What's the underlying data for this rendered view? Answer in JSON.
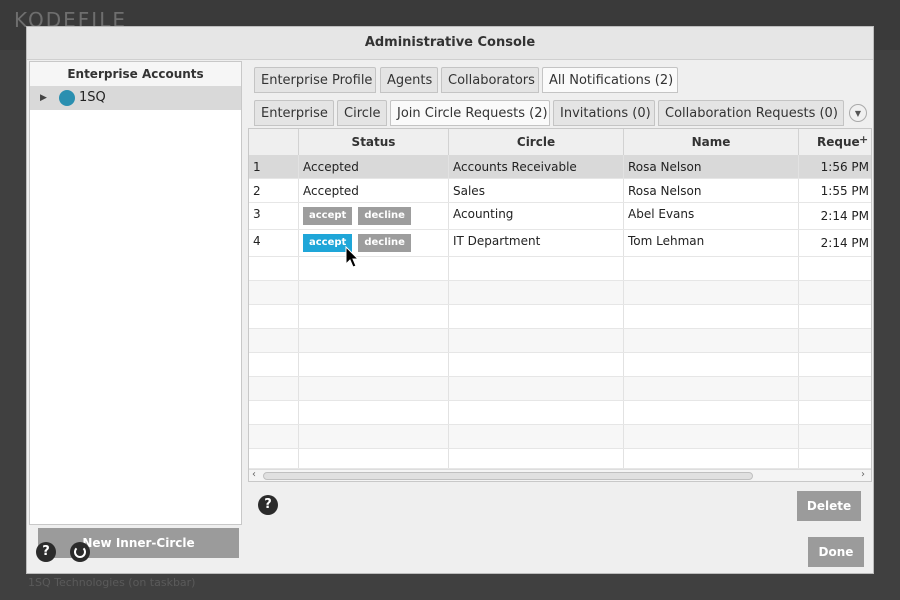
{
  "dialog": {
    "title": "Administrative Console"
  },
  "left_panel": {
    "header": "Enterprise Accounts",
    "tree": [
      {
        "label": "1SQ",
        "icon": "enterprise-icon",
        "expanded": false,
        "selected": true
      }
    ],
    "new_button": "New Inner-Circle"
  },
  "tabs_primary": [
    {
      "label": "Enterprise Profile",
      "active": false
    },
    {
      "label": "Agents",
      "active": false
    },
    {
      "label": "Collaborators",
      "active": false
    },
    {
      "label": "All Notifications (2)",
      "active": true
    }
  ],
  "tabs_secondary": [
    {
      "label": "Enterprise",
      "active": false
    },
    {
      "label": "Circle",
      "active": false
    },
    {
      "label": "Join Circle Requests (2)",
      "active": true
    },
    {
      "label": "Invitations (0)",
      "active": false
    },
    {
      "label": "Collaboration Requests (0)",
      "active": false
    }
  ],
  "table": {
    "columns": [
      "",
      "Status",
      "Circle",
      "Name",
      "Reque"
    ],
    "rows": [
      {
        "num": "1",
        "status": "Accepted",
        "circle": "Accounts Receivable",
        "name": "Rosa Nelson",
        "time": "1:56 PM"
      },
      {
        "num": "2",
        "status": "Accepted",
        "circle": "Sales",
        "name": "Rosa Nelson",
        "time": "1:55 PM"
      },
      {
        "num": "3",
        "status": "",
        "circle": "Acounting",
        "name": "Abel Evans",
        "time": "2:14 PM"
      },
      {
        "num": "4",
        "status": "",
        "circle": "IT Department",
        "name": "Tom Lehman",
        "time": "2:14 PM"
      }
    ],
    "accept_label": "accept",
    "decline_label": "decline"
  },
  "right_footer": {
    "delete_button": "Delete",
    "help_symbol": "?"
  },
  "dialog_footer": {
    "done_button": "Done",
    "help_symbol": "?"
  },
  "colors": {
    "accent": "#1fa6d8",
    "button_gray": "#9b9b9b"
  }
}
